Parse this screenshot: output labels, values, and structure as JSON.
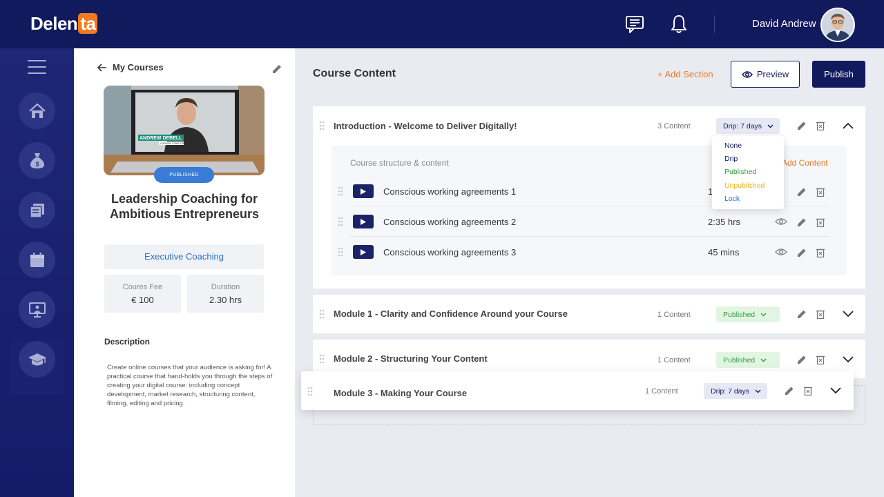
{
  "brand": {
    "logo_main": "Delen",
    "logo_accent": "ta",
    "accent_color": "#f07a20",
    "navy": "#121a5e"
  },
  "header": {
    "user_name": "David Andrew",
    "icons": [
      "chat-icon",
      "bell-icon"
    ]
  },
  "sidebar": {
    "items": [
      "menu-icon",
      "home-icon",
      "money-bag-icon",
      "courses-icon",
      "calendar-icon",
      "presentation-icon",
      "graduation-cap-icon"
    ],
    "active": "graduation-cap-icon"
  },
  "panel": {
    "back_label": "My Courses",
    "thumb_name": "ANDREW DEBELL",
    "thumb_role": "LEARNING CONSULTANT",
    "status_badge": "PUBLISHED",
    "course_title": "Leadership Coaching for Ambitious Entrepreneurs",
    "category": "Executive Coaching",
    "fee_label": "Coures Fee",
    "fee_value": "€ 100",
    "duration_label": "Duration",
    "duration_value": "2.30 hrs",
    "description_heading": "Description",
    "description": "Create online courses that your audience is asking for! A practical course that hand-holds you through the steps of creating your digital course: including concept development, market research, structuring content, filming, editing and pricing."
  },
  "main": {
    "title": "Course Content",
    "add_section": "+ Add Section",
    "preview": "Preview",
    "publish": "Publish",
    "intro": {
      "title": "Introduction - Welcome to Deliver Digitally!",
      "count": "3 Content",
      "status": "Drip: 7 days",
      "structure_label": "Course structure & content",
      "add_content": "Add Content",
      "lessons": [
        {
          "title": "Conscious working agreements 1",
          "duration": "1"
        },
        {
          "title": "Conscious working agreements 2",
          "duration": "2:35 hrs"
        },
        {
          "title": "Conscious working agreements 3",
          "duration": "45 mins"
        }
      ]
    },
    "dropdown_options": [
      {
        "label": "None",
        "color": "#121a5e"
      },
      {
        "label": "Drip",
        "color": "#121a5e"
      },
      {
        "label": "Published",
        "color": "#2e9e3a"
      },
      {
        "label": "Unpublished",
        "color": "#e8b21a"
      },
      {
        "label": "Lock",
        "color": "#2a6fcf"
      }
    ],
    "modules": [
      {
        "title": "Module 1 - Clarity and Confidence Around your Course",
        "count": "1 Content",
        "status": "Published"
      },
      {
        "title": "Module 2 - Structuring Your Content",
        "count": "1 Content",
        "status": "Published"
      },
      {
        "title": "Module 3 - Making Your Course",
        "count": "1 Content",
        "status": "Drip: 7 days"
      }
    ]
  }
}
